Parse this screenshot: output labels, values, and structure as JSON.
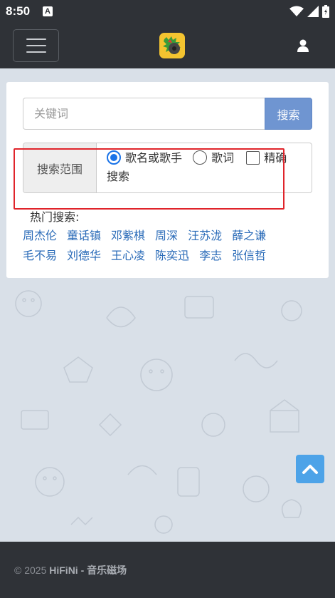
{
  "status_bar": {
    "time": "8:50",
    "notification_icon": "A"
  },
  "navbar": {
    "menu_icon": "hamburger-icon",
    "logo_icon": "site-logo",
    "user_icon": "user-icon"
  },
  "search": {
    "placeholder": "关键词",
    "value": "",
    "button_label": "搜索"
  },
  "range": {
    "label": "搜索范围",
    "options": [
      {
        "label": "歌名或歌手",
        "checked": true
      },
      {
        "label": "歌词",
        "checked": false
      }
    ],
    "exact": {
      "label_line1": "精确",
      "label_line2": "搜索",
      "checked": false
    }
  },
  "hot": {
    "title": "热门搜索:",
    "row1": [
      "周杰伦",
      "童话镇",
      "邓紫棋",
      "周深",
      "汪苏泷",
      "薛之谦"
    ],
    "row2": [
      "毛不易",
      "刘德华",
      "王心凌",
      "陈奕迅",
      "李志",
      "张信哲"
    ]
  },
  "footer": {
    "copyright": "© 2025",
    "brand": "HiFiNi - 音乐磁场"
  },
  "colors": {
    "accent": "#6f95d1",
    "link": "#2a6bb8",
    "annotation": "#e0242b",
    "dark": "#2f3237"
  }
}
